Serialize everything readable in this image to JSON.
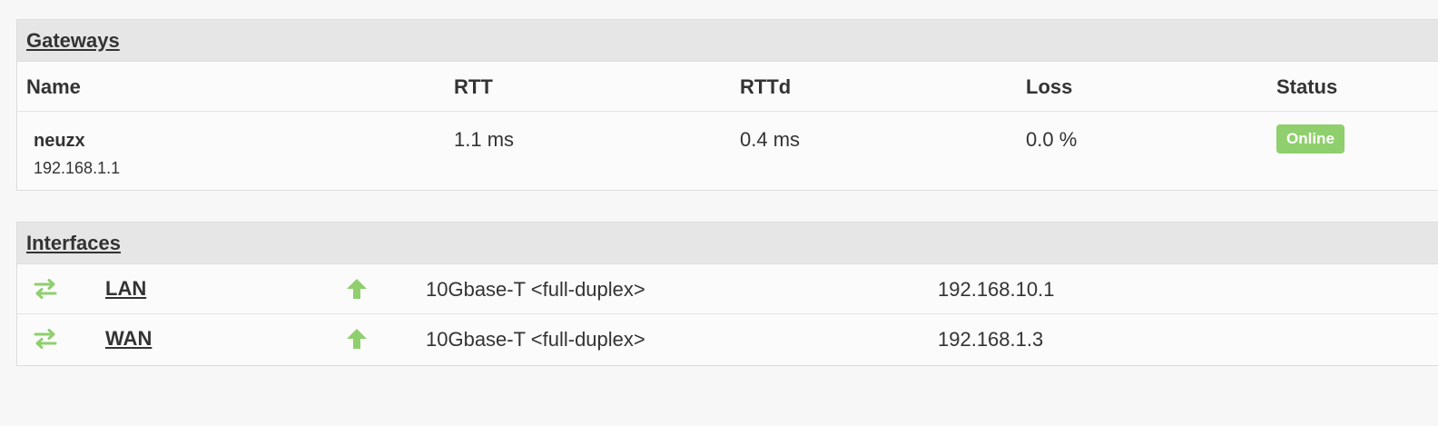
{
  "gateways": {
    "title": "Gateways",
    "columns": [
      "Name",
      "RTT",
      "RTTd",
      "Loss",
      "Status"
    ],
    "rows": [
      {
        "name": "neuzx",
        "address": "192.168.1.1",
        "rtt": "1.1 ms",
        "rttd": "0.4 ms",
        "loss": "0.0 %",
        "status": "Online",
        "status_color": "#8fcf6d"
      }
    ]
  },
  "interfaces": {
    "title": "Interfaces",
    "rows": [
      {
        "icon": "swap-arrows-icon",
        "name": "LAN",
        "status_icon": "arrow-up-icon",
        "media": "10Gbase-T <full-duplex>",
        "ip": "192.168.10.1"
      },
      {
        "icon": "swap-arrows-icon",
        "name": "WAN",
        "status_icon": "arrow-up-icon",
        "media": "10Gbase-T <full-duplex>",
        "ip": "192.168.1.3"
      }
    ],
    "icon_color": "#8fcf6d"
  }
}
